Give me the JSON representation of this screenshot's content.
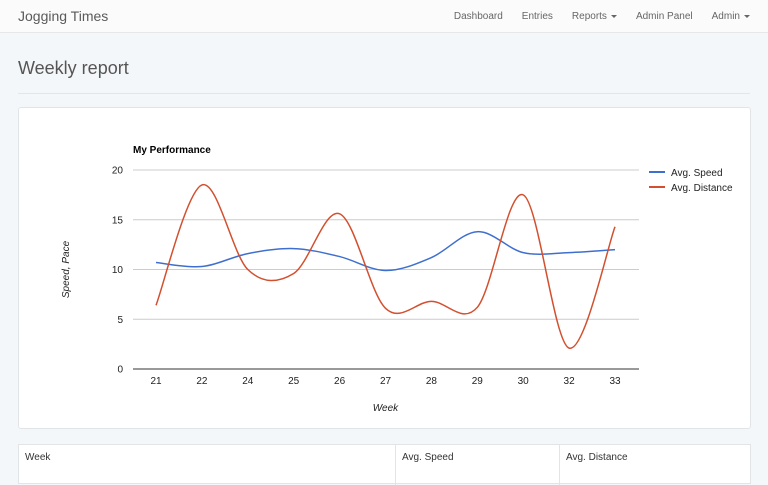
{
  "navbar": {
    "brand": "Jogging Times",
    "items": [
      {
        "label": "Dashboard",
        "dropdown": false
      },
      {
        "label": "Entries",
        "dropdown": false
      },
      {
        "label": "Reports",
        "dropdown": true
      },
      {
        "label": "Admin Panel",
        "dropdown": false
      },
      {
        "label": "Admin",
        "dropdown": true
      }
    ]
  },
  "page": {
    "title": "Weekly report"
  },
  "chart_data": {
    "type": "line",
    "title": "My Performance",
    "xlabel": "Week",
    "ylabel": "Speed, Pace",
    "categories": [
      "21",
      "22",
      "24",
      "25",
      "26",
      "27",
      "28",
      "29",
      "30",
      "32",
      "33"
    ],
    "ylim": [
      0,
      20
    ],
    "yticks": [
      "0",
      "5",
      "10",
      "15",
      "20"
    ],
    "grid": true,
    "legend_position": "right",
    "series": [
      {
        "name": "Avg. Speed",
        "color": "#3f6fce",
        "values": [
          10.7,
          10.3,
          11.6,
          12.1,
          11.3,
          9.9,
          11.2,
          13.8,
          11.7,
          11.7,
          12.0
        ]
      },
      {
        "name": "Avg. Distance",
        "color": "#d2502f",
        "values": [
          6.4,
          18.5,
          10.0,
          9.6,
          15.6,
          6.1,
          6.8,
          6.2,
          17.5,
          2.1,
          14.3
        ]
      }
    ]
  },
  "table": {
    "headers": [
      "Week",
      "Avg. Speed",
      "Avg. Distance"
    ]
  }
}
